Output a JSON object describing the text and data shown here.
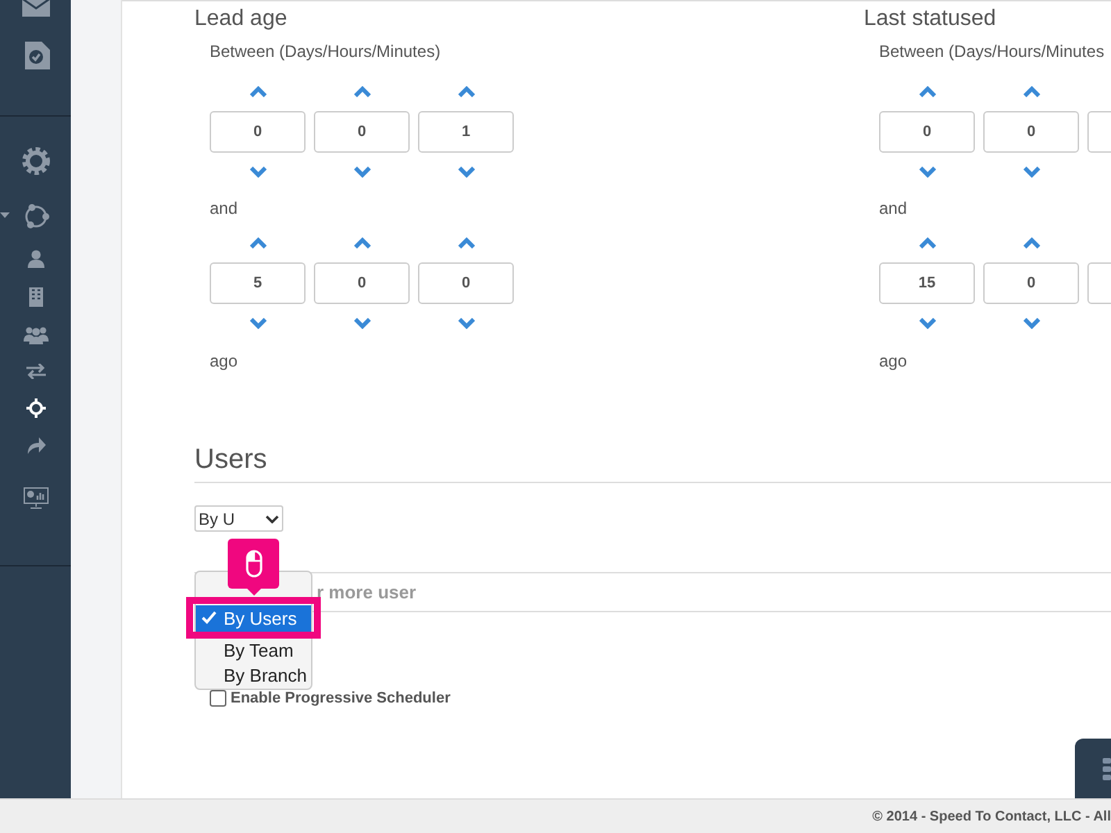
{
  "sidebar": {
    "items": [
      {
        "kind": "mail",
        "selected": false
      },
      {
        "kind": "task",
        "selected": false
      },
      {
        "kind": "gear",
        "selected": false
      },
      {
        "kind": "share",
        "selected": false,
        "expandable": true
      },
      {
        "kind": "user",
        "selected": false
      },
      {
        "kind": "building",
        "selected": false
      },
      {
        "kind": "group",
        "selected": false
      },
      {
        "kind": "transfer",
        "selected": false
      },
      {
        "kind": "target",
        "selected": true
      },
      {
        "kind": "forward",
        "selected": false
      },
      {
        "kind": "monitor",
        "selected": false
      }
    ]
  },
  "filters": [
    {
      "title": "Lead age",
      "between_label": "Between (Days/Hours/Minutes)",
      "from": [
        "0",
        "0",
        "1"
      ],
      "and_label": "and",
      "to": [
        "5",
        "0",
        "0"
      ],
      "ago_label": "ago"
    },
    {
      "title": "Last statused",
      "between_label": "Between (Days/Hours/Minutes",
      "from": [
        "0",
        "0"
      ],
      "and_label": "and",
      "to": [
        "15",
        "0"
      ],
      "ago_label": "ago"
    }
  ],
  "users": {
    "title": "Users",
    "select": {
      "value": "By U"
    },
    "options": [
      {
        "label": "By Users",
        "selected": true
      },
      {
        "label": "By Team",
        "selected": false
      },
      {
        "label": "By Branch",
        "selected": false
      }
    ],
    "field": {
      "placeholder": "r more user"
    }
  },
  "progressive_scheduler": {
    "label": "Enable Progressive Scheduler",
    "checked": false
  },
  "footer": {
    "text": "© 2014 - Speed To Contact, LLC - All"
  }
}
